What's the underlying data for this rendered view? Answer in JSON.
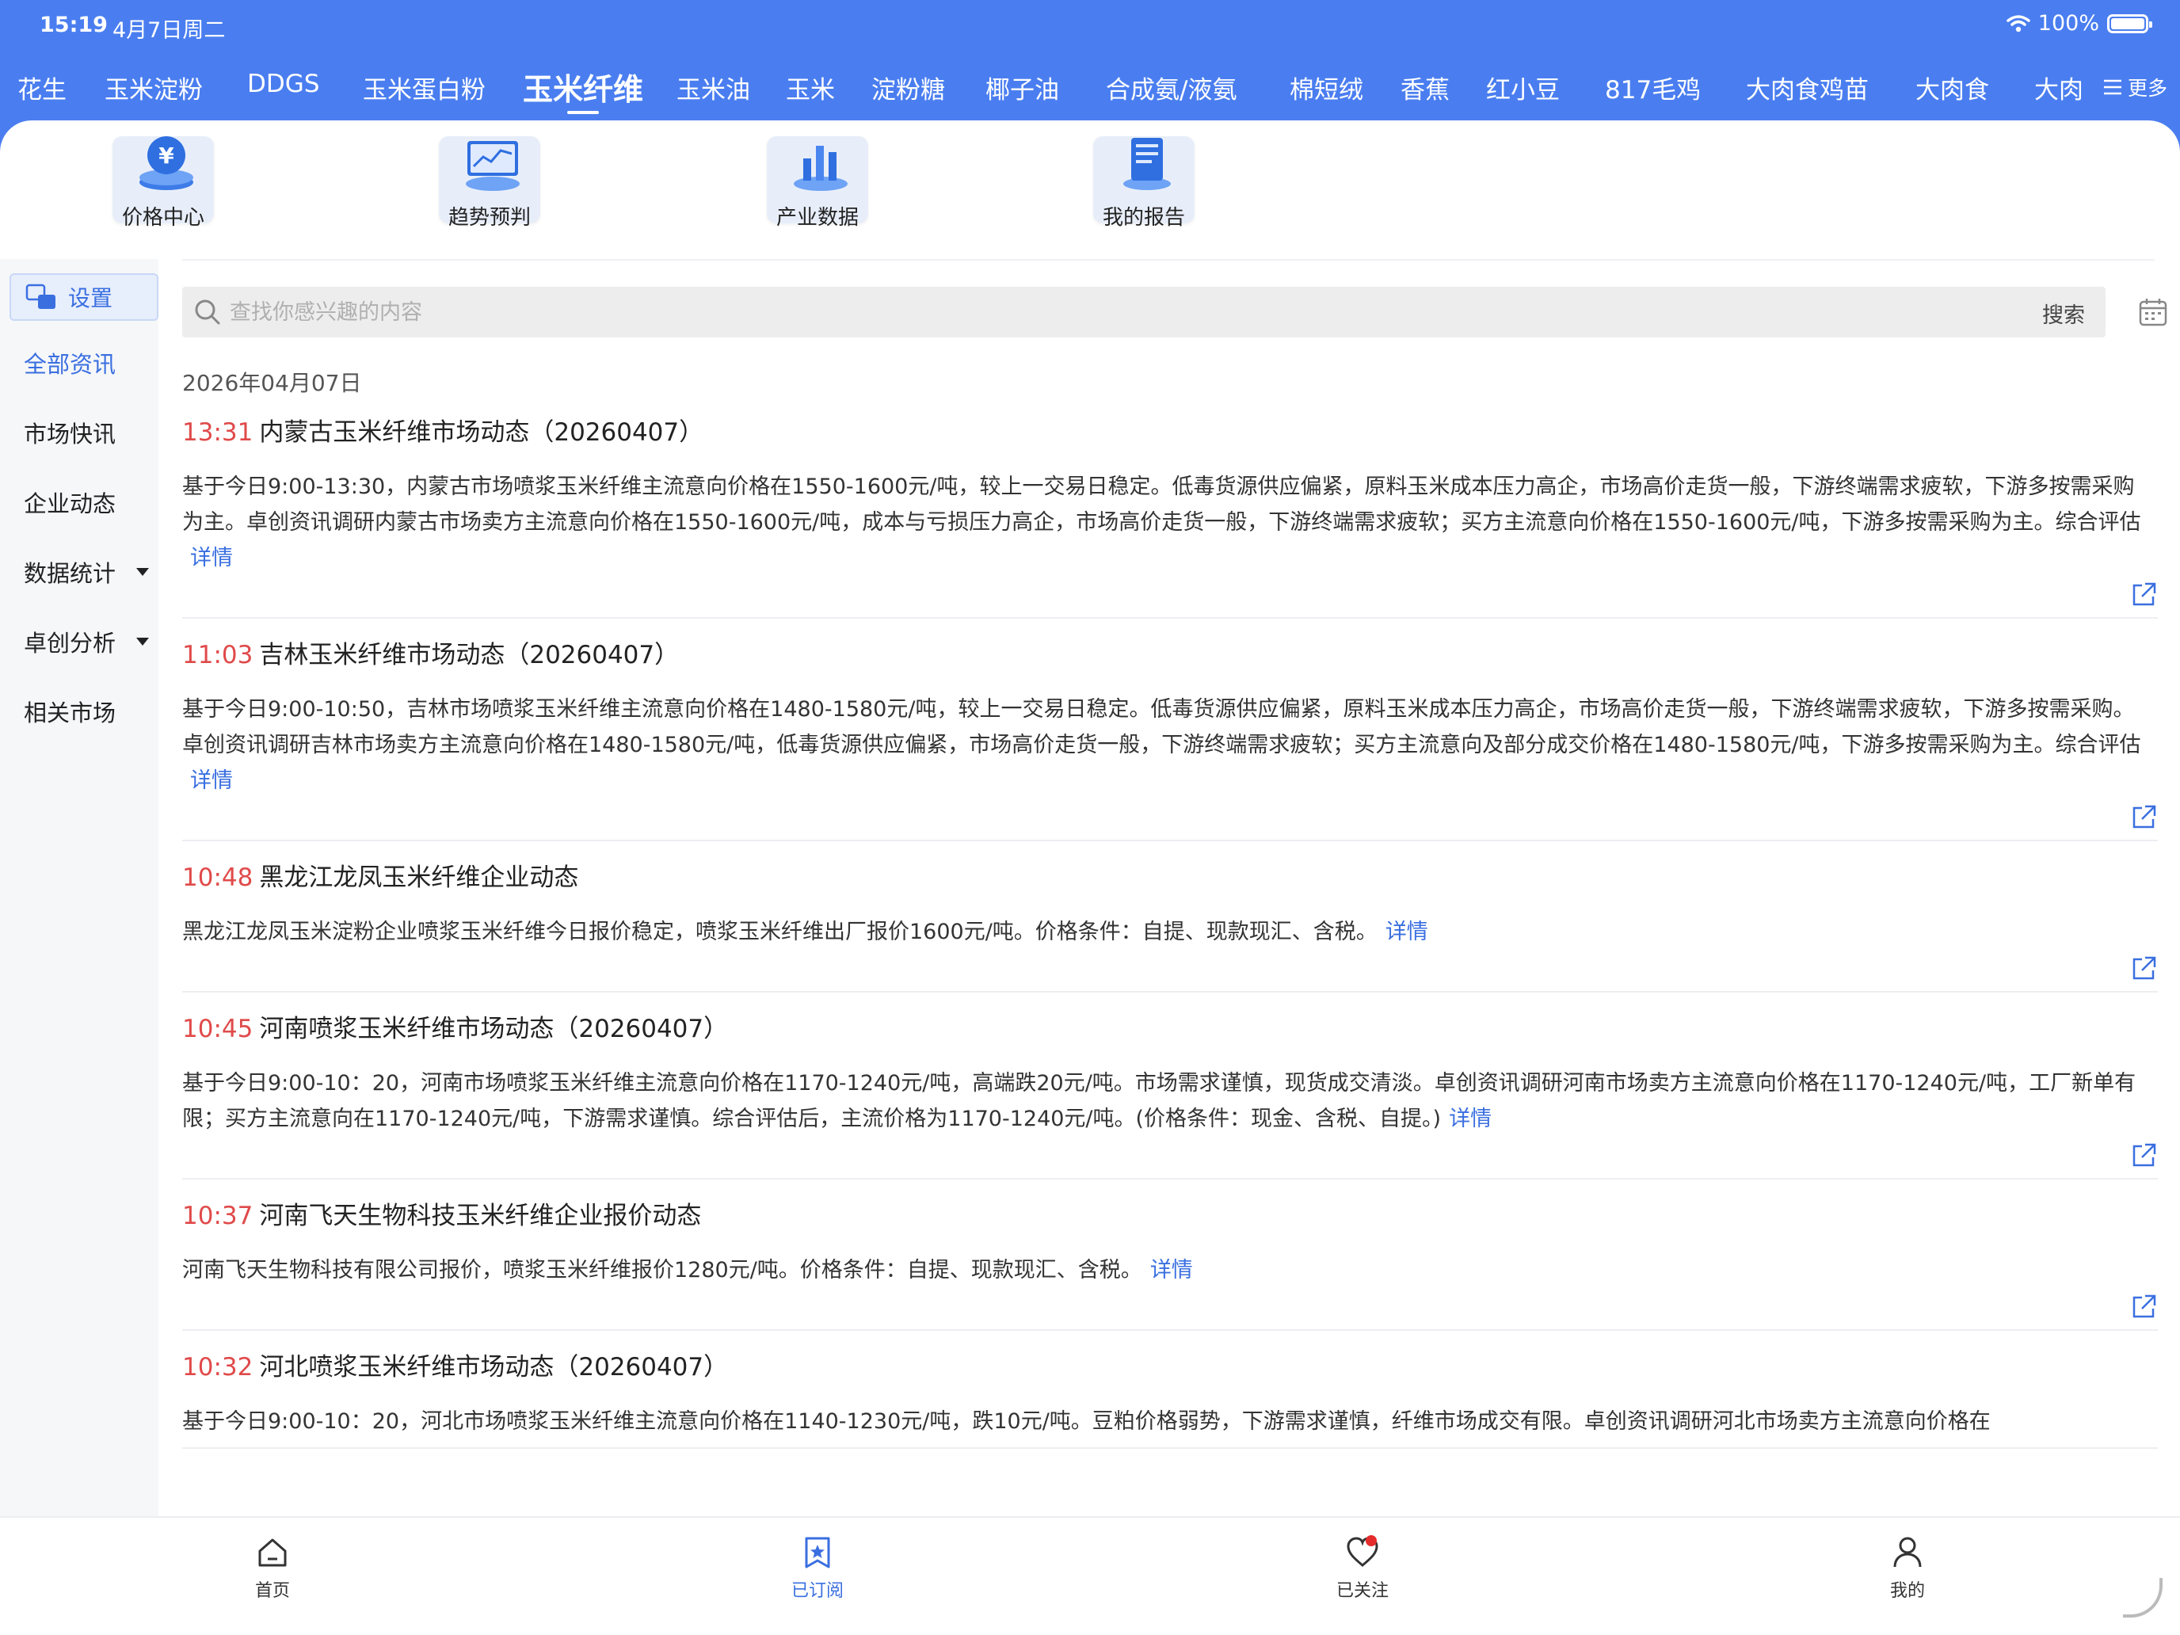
{
  "status_bar": {
    "time": "15:19",
    "date": "4月7日周二",
    "battery": "100%"
  },
  "categories": {
    "items": [
      "花生",
      "玉米淀粉",
      "DDGS",
      "玉米蛋白粉",
      "玉米纤维",
      "玉米油",
      "玉米",
      "淀粉糖",
      "椰子油",
      "合成氨/液氨",
      "棉短绒",
      "香蕉",
      "红小豆",
      "817毛鸡",
      "大肉食鸡苗",
      "大肉食",
      "大肉"
    ],
    "active": "玉米纤维",
    "more_label": "更多"
  },
  "quick_actions": {
    "price_center": "价格中心",
    "trend": "趋势预判",
    "industry_data": "产业数据",
    "my_report": "我的报告"
  },
  "sidebar": {
    "settings_label": "设置",
    "items": [
      "全部资讯",
      "市场快讯",
      "企业动态",
      "数据统计",
      "卓创分析",
      "相关市场"
    ],
    "active": "全部资讯"
  },
  "search": {
    "placeholder": "查找你感兴趣的内容",
    "button": "搜索"
  },
  "date_header": "2026年04月07日",
  "feed": [
    {
      "time": "13:31",
      "title": "内蒙古玉米纤维市场动态（20260407）",
      "body": "基于今日9:00-13:30，内蒙古市场喷浆玉米纤维主流意向价格在1550-1600元/吨，较上一交易日稳定。低毒货源供应偏紧，原料玉米成本压力高企，市场高价走货一般，下游终端需求疲软，下游多按需采购为主。卓创资讯调研内蒙古市场卖方主流意向价格在1550-1600元/吨，成本与亏损压力高企，市场高价走货一般，下游终端需求疲软；买方主流意向价格在1550-1600元/吨，下游多按需采购为主。综合评估",
      "detail": "详情"
    },
    {
      "time": "11:03",
      "title": "吉林玉米纤维市场动态（20260407）",
      "body": "基于今日9:00-10:50，吉林市场喷浆玉米纤维主流意向价格在1480-1580元/吨，较上一交易日稳定。低毒货源供应偏紧，原料玉米成本压力高企，市场高价走货一般，下游终端需求疲软，下游多按需采购。卓创资讯调研吉林市场卖方主流意向价格在1480-1580元/吨，低毒货源供应偏紧，市场高价走货一般，下游终端需求疲软；买方主流意向及部分成交价格在1480-1580元/吨，下游多按需采购为主。综合评估",
      "detail": "详情"
    },
    {
      "time": "10:48",
      "title": "黑龙江龙凤玉米纤维企业动态",
      "body": "黑龙江龙凤玉米淀粉企业喷浆玉米纤维今日报价稳定，喷浆玉米纤维出厂报价1600元/吨。价格条件：自提、现款现汇、含税。",
      "detail": "详情"
    },
    {
      "time": "10:45",
      "title": "河南喷浆玉米纤维市场动态（20260407）",
      "body": "基于今日9:00-10：20，河南市场喷浆玉米纤维主流意向价格在1170-1240元/吨，高端跌20元/吨。市场需求谨慎，现货成交清淡。卓创资讯调研河南市场卖方主流意向价格在1170-1240元/吨，工厂新单有限；买方主流意向在1170-1240元/吨，下游需求谨慎。综合评估后，主流价格为1170-1240元/吨。(价格条件：现金、含税、自提。)",
      "detail": "详情"
    },
    {
      "time": "10:37",
      "title": "河南飞天生物科技玉米纤维企业报价动态",
      "body": "河南飞天生物科技有限公司报价，喷浆玉米纤维报价1280元/吨。价格条件：自提、现款现汇、含税。",
      "detail": "详情"
    },
    {
      "time": "10:32",
      "title": "河北喷浆玉米纤维市场动态（20260407）",
      "body": "基于今日9:00-10：20，河北市场喷浆玉米纤维主流意向价格在1140-1230元/吨，跌10元/吨。豆粕价格弱势，下游需求谨慎，纤维市场成交有限。卓创资讯调研河北市场卖方主流意向价格在",
      "detail": ""
    }
  ],
  "tabbar": {
    "home": "首页",
    "subscribed": "已订阅",
    "following": "已关注",
    "mine": "我的",
    "active": "已订阅"
  },
  "colors": {
    "brand_blue": "#4a7ef0",
    "accent_blue": "#3a6fe0",
    "time_red": "#e04a4a"
  }
}
